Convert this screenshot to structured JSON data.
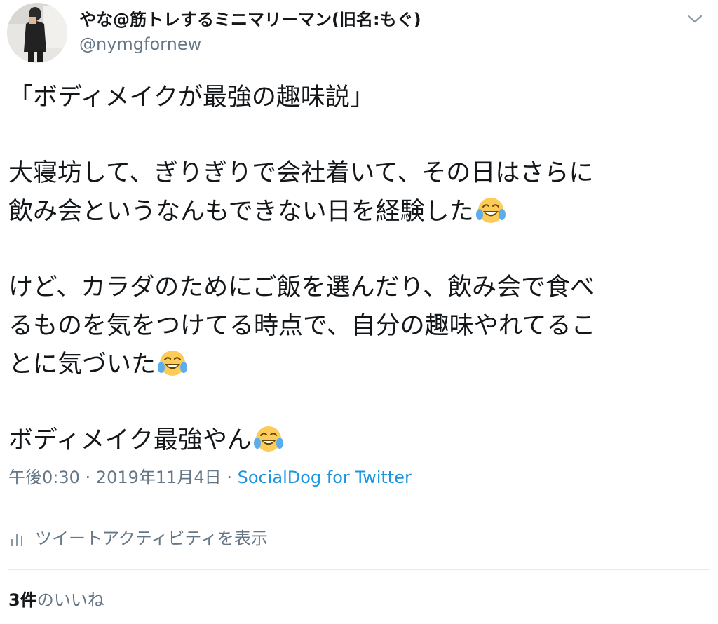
{
  "user": {
    "display_name": "やな@筋トレするミニマリーマン(旧名:もぐ)",
    "handle": "@nymgfornew",
    "avatar_icon": "profile-photo"
  },
  "menu": {
    "icon": "chevron-down-icon"
  },
  "tweet": {
    "paragraphs": [
      {
        "lines": [
          "「ボディメイクが最強の趣味説」"
        ],
        "emoji": [
          false
        ]
      },
      {
        "lines": [
          "大寝坊して、ぎりぎりで会社着いて、その日はさらに",
          "飲み会というなんもできない日を経験した"
        ],
        "emoji": [
          false,
          true
        ]
      },
      {
        "lines": [
          "けど、カラダのためにご飯を選んだり、飲み会で食べ",
          "るものを気をつけてる時点で、自分の趣味やれてるこ",
          "とに気づいた"
        ],
        "emoji": [
          false,
          false,
          true
        ]
      },
      {
        "lines": [
          "ボディメイク最強やん"
        ],
        "emoji": [
          true
        ]
      }
    ],
    "emoji_name": "face-with-tears-of-joy",
    "time": "午後0:30",
    "separator": " · ",
    "date": "2019年11月4日",
    "source": "SocialDog for Twitter"
  },
  "activity": {
    "label": "ツイートアクティビティを表示",
    "icon": "bar-chart-icon"
  },
  "likes": {
    "count": "3件",
    "label": "のいいね"
  },
  "colors": {
    "text": "#14171a",
    "secondary": "#657786",
    "link": "#1b95e0",
    "divider": "#e6ecf0",
    "emoji_face": "#fdcb58",
    "emoji_tears": "#5dadec"
  }
}
